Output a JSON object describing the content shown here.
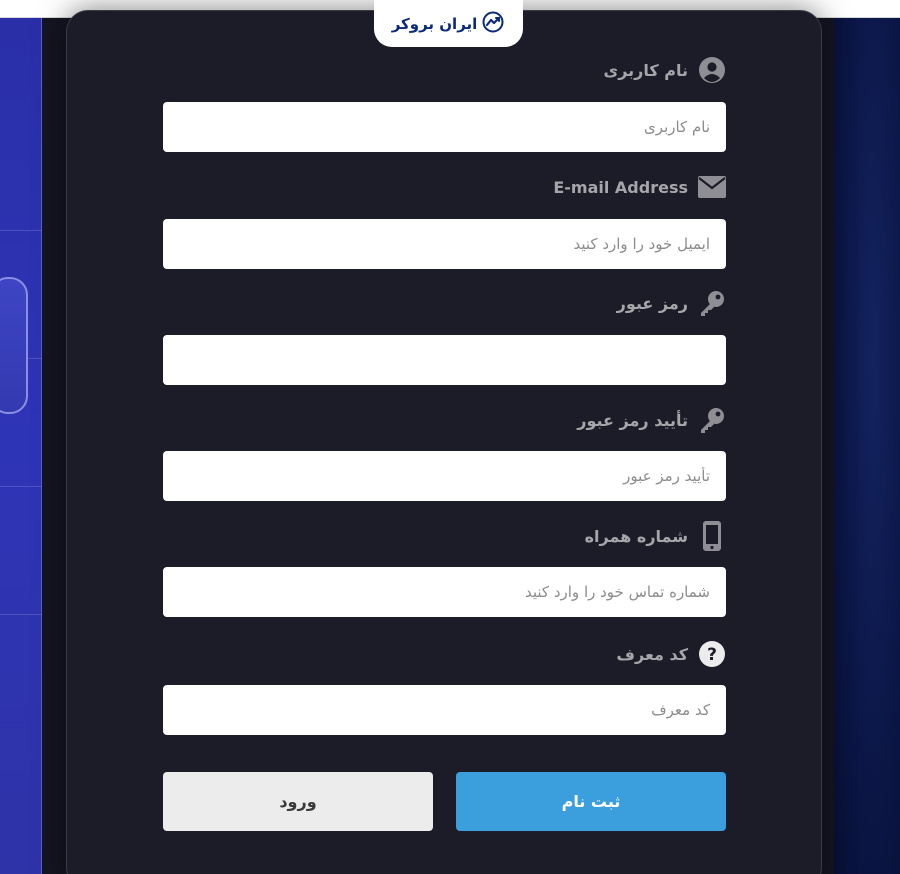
{
  "brand": {
    "logo_text": "ایران بروکر"
  },
  "form": {
    "username": {
      "label": "نام کاربری",
      "placeholder": "نام کاربری",
      "value": ""
    },
    "email": {
      "label": "E-mail Address",
      "placeholder": "ایمیل خود را وارد کنید",
      "value": ""
    },
    "password": {
      "label": "رمز عبور",
      "placeholder": "",
      "value": ""
    },
    "confirm_password": {
      "label": "تأیید رمز عبور",
      "placeholder": "تأیید رمز عبور",
      "value": ""
    },
    "phone": {
      "label": "شماره همراه",
      "placeholder": "شماره تماس خود را وارد کنید",
      "value": ""
    },
    "referral": {
      "label": "کد معرف",
      "placeholder": "کد معرف",
      "value": ""
    }
  },
  "actions": {
    "login_label": "ورود",
    "register_label": "ثبت نام"
  },
  "colors": {
    "panel_bg": "#1b1c27",
    "label_text": "#a6a6aa",
    "icon_gray": "#8e8e94",
    "register_button": "#3a9fdc",
    "login_button": "#ececec",
    "brand_blue": "#0b2a7a"
  },
  "icons": {
    "username": "user-circle-icon",
    "email": "envelope-icon",
    "password": "key-icon",
    "confirm_password": "key-icon",
    "phone": "mobile-phone-icon",
    "referral": "question-circle-icon",
    "brand": "trend-chart-icon"
  }
}
